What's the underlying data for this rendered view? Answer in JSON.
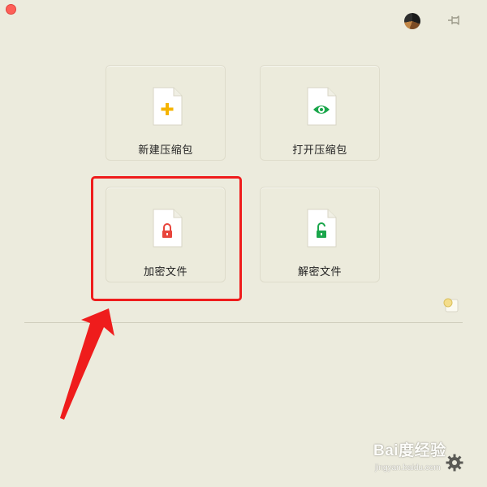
{
  "window": {
    "close_color": "#fe5f57"
  },
  "toolbar": {
    "avatar_icon": "user-avatar",
    "pin_icon": "pin-icon"
  },
  "tiles": [
    {
      "label": "新建压缩包",
      "icon": "new-archive-plus-icon",
      "accent": "#f5b400"
    },
    {
      "label": "打开压缩包",
      "icon": "open-archive-eye-icon",
      "accent": "#1aa64b"
    },
    {
      "label": "加密文件",
      "icon": "encrypt-lock-icon",
      "accent": "#e8453c"
    },
    {
      "label": "解密文件",
      "icon": "decrypt-unlock-icon",
      "accent": "#1aa64b"
    }
  ],
  "annotation": {
    "highlight_color": "#ef1c1c",
    "arrow_color": "#ef1c1c"
  },
  "footer": {
    "notes_icon": "notes-icon",
    "settings_icon": "gear-icon"
  },
  "watermark": {
    "brand": "Bai度经验",
    "url": "jingyan.baidu.com"
  }
}
